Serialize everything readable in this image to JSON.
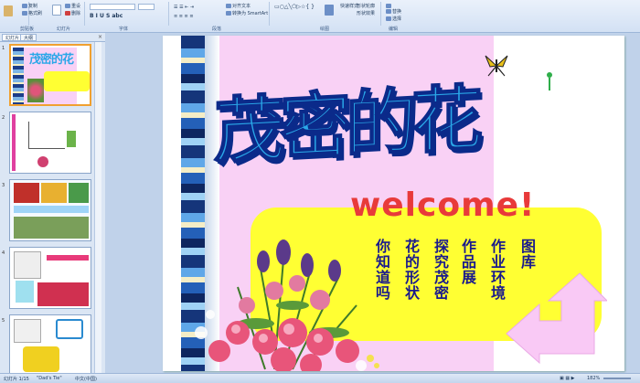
{
  "ribbon": {
    "groups": [
      {
        "name": "clipboard",
        "label": "剪贴板",
        "items": [
          "复制",
          "格式刷"
        ]
      },
      {
        "name": "slides",
        "label": "幻灯片",
        "items": [
          "重设",
          "删除"
        ]
      },
      {
        "name": "font",
        "label": "字体",
        "items": []
      },
      {
        "name": "paragraph",
        "label": "段落",
        "items": [
          "对齐文本",
          "转换为 SmartArt"
        ]
      },
      {
        "name": "drawing",
        "label": "绘图",
        "items": [
          "快速样式",
          "形状轮廓",
          "形状效果"
        ]
      },
      {
        "name": "editing",
        "label": "编辑",
        "items": [
          "替换",
          "选择"
        ]
      }
    ]
  },
  "panel_tabs": [
    "幻灯片",
    "大纲"
  ],
  "thumb_numbers": [
    "1",
    "2",
    "3",
    "4",
    "5"
  ],
  "thumb1_title": "茂密的花",
  "slide": {
    "title": "茂密的花",
    "welcome": "welcome!",
    "menu": [
      "图库",
      "作业环境",
      "作品展",
      "探究茂密",
      "花的形状",
      "你知道吗"
    ]
  },
  "status": {
    "slide_info": "幻灯片 1/15",
    "theme": "\"Dad's Tie\"",
    "language": "中文(中国)",
    "zoom": "182%"
  },
  "colors": {
    "title_blue": "#2aa7e8",
    "menu_navy": "#1a1a8c",
    "pink_bg": "#f9d1f5",
    "yellow_box": "#ffff33"
  }
}
